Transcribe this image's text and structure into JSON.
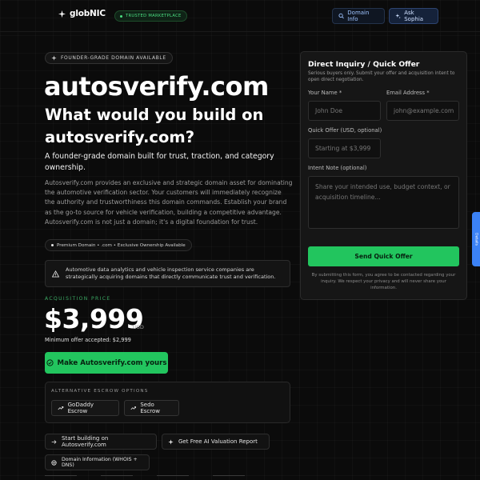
{
  "header": {
    "logo_text": "globNIC",
    "trusted_badge": "TRUSTED MARKETPLACE",
    "domain_info_label": "Domain Info",
    "ask_sophia_label": "Ask Sophia"
  },
  "hero": {
    "pill": "FOUNDER-GRADE DOMAIN AVAILABLE",
    "title": "autosverify.com",
    "subtitle": "What would you build on autosverify.com?",
    "tagline": "A founder-grade domain built for trust, traction, and category ownership.",
    "description": "Autosverify.com provides an exclusive and strategic domain asset for dominating the automotive verification sector. Your customers will immediately recognize the authority and trustworthiness this domain commands. Establish your brand as the go-to source for vehicle verification, building a competitive advantage. Autosverify.com is not just a domain; it's a digital foundation for trust.",
    "premium_badge": "Premium Domain • .com • Exclusive Ownership Available",
    "alert": "Automotive data analytics and vehicle inspection service companies are strategically acquiring domains that directly communicate trust and verification."
  },
  "pricing": {
    "label": "ACQUISITION PRICE",
    "price": "$3,999",
    "currency": "USD",
    "min_offer": "Minimum offer accepted: $2,999",
    "cta": "Make Autosverify.com yours"
  },
  "escrow": {
    "title": "ALTERNATIVE ESCROW OPTIONS",
    "godaddy": "GoDaddy Escrow",
    "sedo": "Sedo Escrow"
  },
  "links": {
    "build": "Start building on Autosverify.com",
    "ai": "Get Free AI Valuation Report",
    "whois": "Domain Information (WHOIS + DNS)"
  },
  "form": {
    "title": "Direct Inquiry / Quick Offer",
    "subtitle": "Serious buyers only. Submit your offer and acquisition intent to open direct negotiation.",
    "name_label": "Your Name *",
    "name_placeholder": "John Doe",
    "email_label": "Email Address *",
    "email_placeholder": "john@example.com",
    "offer_label": "Quick Offer (USD, optional)",
    "offer_placeholder": "Starting at $3,999",
    "note_label": "Intent Note (optional)",
    "note_placeholder": "Share your intended use, budget context, or acquisition timeline...",
    "submit": "Send Quick Offer",
    "disclaimer": "By submitting this form, you agree to be contacted regarding your inquiry. We respect your privacy and will never share your information."
  },
  "side_tab": "Details",
  "colors": {
    "accent": "#22c55e",
    "background": "#0b0b0b",
    "link_blue": "#3b82f6"
  }
}
